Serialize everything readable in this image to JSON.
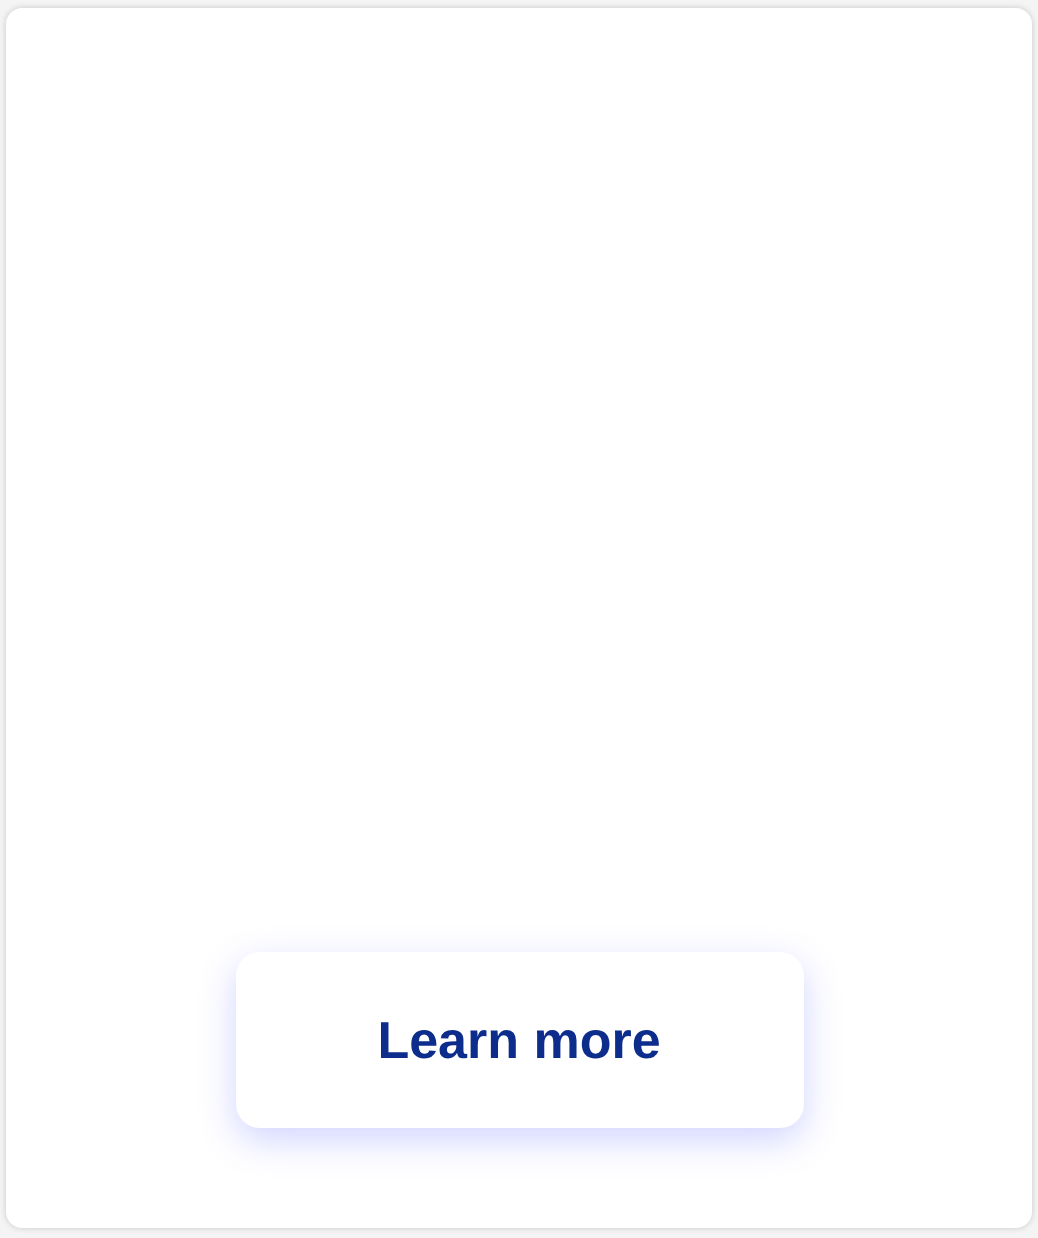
{
  "button": {
    "label": "Learn more"
  }
}
